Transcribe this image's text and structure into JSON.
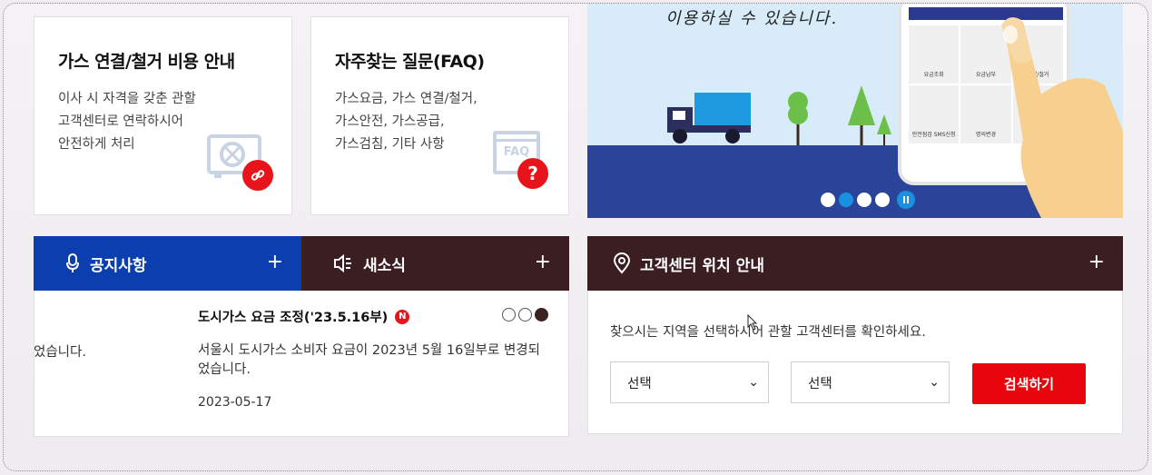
{
  "cards": [
    {
      "title": "가스 연결/철거 비용 안내",
      "lines": [
        "이사 시 자격을 갖춘 관할",
        "고객센터로 연락하시어",
        "안전하게 처리"
      ],
      "badge_icon": "link-icon"
    },
    {
      "title": "자주찾는 질문(FAQ)",
      "lines": [
        "가스요금, 가스 연결/철거,",
        "가스안전, 가스공급,",
        "가스검침, 기타 사항"
      ],
      "badge_icon": "question-icon",
      "badge_text": "?",
      "ill_text": "FAQ"
    }
  ],
  "banner": {
    "slogan": "이용하실 수 있습니다.",
    "phone_menu": [
      "요금조회",
      "요금납부",
      "연결/철거",
      "안전점검 SMS신청",
      "명의변경"
    ],
    "slides": 4,
    "active_slide": 2
  },
  "tabs": {
    "notice": {
      "label": "공지사항",
      "color": "#0b3fb0"
    },
    "news": {
      "label": "새소식",
      "color": "#3a1e22"
    },
    "location": {
      "label": "고객센터 위치 안내",
      "color": "#3a1e22"
    },
    "plus": "+"
  },
  "notice": {
    "title": "도시가스 요금 조정('23.5.16부)",
    "new_badge": "N",
    "body": "서울시 도시가스 소비자 요금이 2023년 5월 16일부로 변경되었습니다.",
    "date": "2023-05-17",
    "prev_fragment": "었습니다.",
    "pages": 3,
    "active_page": 3
  },
  "location": {
    "description": "찾으시는 지역을 선택하시어 관할 고객센터를 확인하세요.",
    "select1": "선택",
    "select2": "선택",
    "search_label": "검색하기"
  },
  "colors": {
    "accent_red": "#e8050c",
    "brand_blue": "#0b3fb0",
    "dark_brown": "#3a1e22"
  }
}
